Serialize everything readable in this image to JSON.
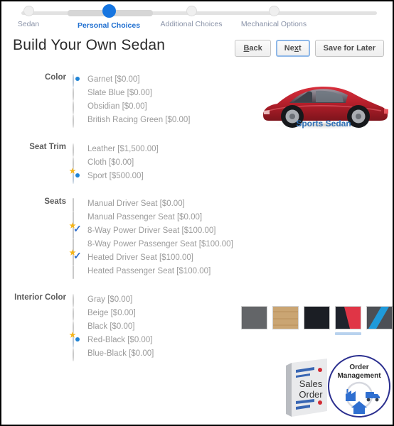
{
  "steps": [
    {
      "label": "Sedan",
      "state": "inactive"
    },
    {
      "label": "Personal Choices",
      "state": "current"
    },
    {
      "label": "Additional Choices",
      "state": "inactive"
    },
    {
      "label": "Mechanical Options",
      "state": "inactive"
    }
  ],
  "page_title": "Build Your Own Sedan",
  "toolbar": {
    "back_label": "Back",
    "next_label": "Next",
    "save_label": "Save for Later"
  },
  "preview": {
    "caption": "Sports Sedan",
    "car_body_color": "#b51f2a",
    "car_icon": "red-sports-car-side-view"
  },
  "sections": {
    "color": {
      "label": "Color",
      "type": "radio",
      "options": [
        {
          "label": "Garnet [$0.00]",
          "checked": true,
          "badge": false
        },
        {
          "label": "Slate Blue [$0.00]",
          "checked": false,
          "badge": false
        },
        {
          "label": "Obsidian [$0.00]",
          "checked": false,
          "badge": false
        },
        {
          "label": "British Racing Green [$0.00]",
          "checked": false,
          "badge": false
        }
      ]
    },
    "seat_trim": {
      "label": "Seat Trim",
      "type": "radio",
      "options": [
        {
          "label": "Leather [$1,500.00]",
          "checked": false,
          "badge": false
        },
        {
          "label": "Cloth [$0.00]",
          "checked": false,
          "badge": false
        },
        {
          "label": "Sport [$500.00]",
          "checked": true,
          "badge": true
        }
      ]
    },
    "seats": {
      "label": "Seats",
      "type": "checkbox",
      "options": [
        {
          "label": "Manual Driver Seat [$0.00]",
          "checked": false,
          "badge": false
        },
        {
          "label": "Manual Passenger Seat [$0.00]",
          "checked": false,
          "badge": false
        },
        {
          "label": "8-Way Power Driver Seat [$100.00]",
          "checked": true,
          "badge": true
        },
        {
          "label": "8-Way Power Passenger Seat [$100.00]",
          "checked": false,
          "badge": false
        },
        {
          "label": "Heated Driver Seat [$100.00]",
          "checked": true,
          "badge": true
        },
        {
          "label": "Heated Passenger Seat [$100.00]",
          "checked": false,
          "badge": false
        }
      ]
    },
    "interior_color": {
      "label": "Interior Color",
      "type": "radio",
      "options": [
        {
          "label": "Gray [$0.00]",
          "checked": false,
          "badge": false
        },
        {
          "label": "Beige [$0.00]",
          "checked": false,
          "badge": false
        },
        {
          "label": "Black [$0.00]",
          "checked": false,
          "badge": false
        },
        {
          "label": "Red-Black [$0.00]",
          "checked": true,
          "badge": true
        },
        {
          "label": "Blue-Black [$0.00]",
          "checked": false,
          "badge": false
        }
      ]
    }
  },
  "swatches": [
    {
      "name": "gray-swatch",
      "selected": false
    },
    {
      "name": "beige-swatch",
      "selected": false
    },
    {
      "name": "black-swatch",
      "selected": false
    },
    {
      "name": "red-black-swatch",
      "selected": true
    },
    {
      "name": "blue-black-swatch",
      "selected": false
    }
  ],
  "badges": {
    "sales_order_line1": "Sales",
    "sales_order_line2": "Order",
    "order_management_line1": "Order",
    "order_management_line2": "Management"
  },
  "colors": {
    "accent_blue": "#1675e0",
    "caption_blue": "#2f6fb5",
    "label_gray": "#5c5c5c",
    "option_gray": "#9b9b9b",
    "swatch_gray": "#58595b",
    "swatch_beige": "#c9a273",
    "swatch_black": "#1d2026",
    "swatch_red": "#e03546",
    "swatch_blue": "#1f9ada"
  }
}
